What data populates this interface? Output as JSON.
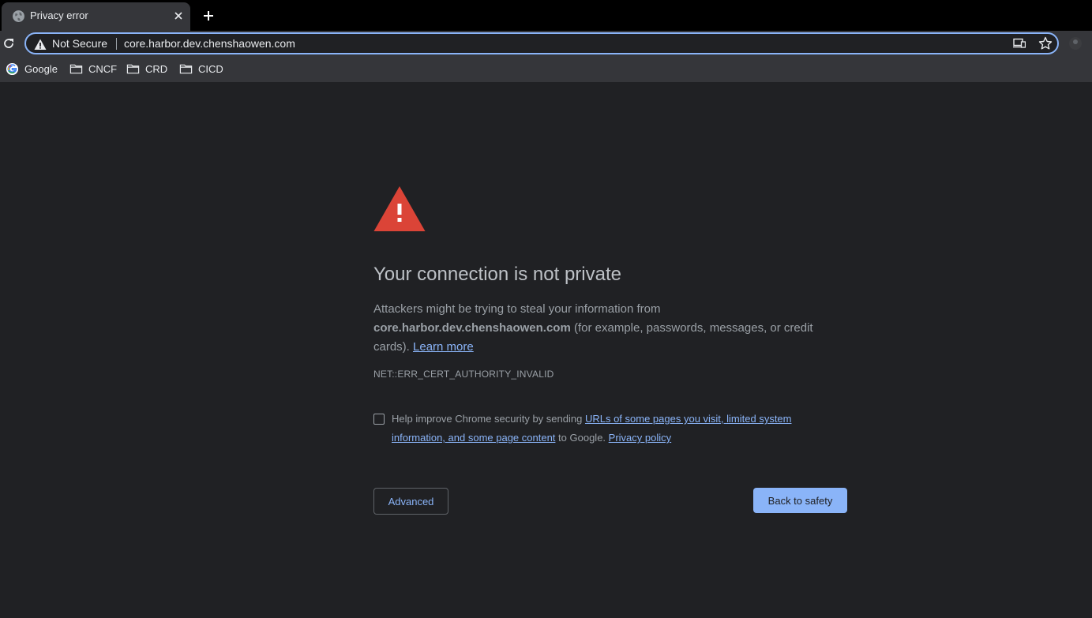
{
  "tab": {
    "title": "Privacy error",
    "favicon": "globe-icon"
  },
  "toolbar": {
    "security_chip": "Not Secure",
    "url": "core.harbor.dev.chenshaowen.com"
  },
  "bookmarks": [
    {
      "label": "Google",
      "icon": "google-icon"
    },
    {
      "label": "CNCF",
      "icon": "folder-icon"
    },
    {
      "label": "CRD",
      "icon": "folder-icon"
    },
    {
      "label": "CICD",
      "icon": "folder-icon"
    }
  ],
  "interstitial": {
    "heading": "Your connection is not private",
    "body_prefix": "Attackers might be trying to steal your information from",
    "host": "core.harbor.dev.chenshaowen.com",
    "body_suffix": "(for example, passwords, messages, or credit cards).",
    "learn_more": "Learn more",
    "error_code": "NET::ERR_CERT_AUTHORITY_INVALID",
    "opt_in_prefix": "Help improve Chrome security by sending",
    "opt_in_link": "URLs of some pages you visit, limited system information, and some page content",
    "opt_in_middle": "to Google.",
    "privacy_policy": "Privacy policy",
    "advanced_label": "Advanced",
    "back_label": "Back to safety"
  },
  "colors": {
    "page_bg": "#202124",
    "chrome_bg": "#35363a",
    "accent": "#8ab4f8",
    "warning_red": "#db4437"
  }
}
